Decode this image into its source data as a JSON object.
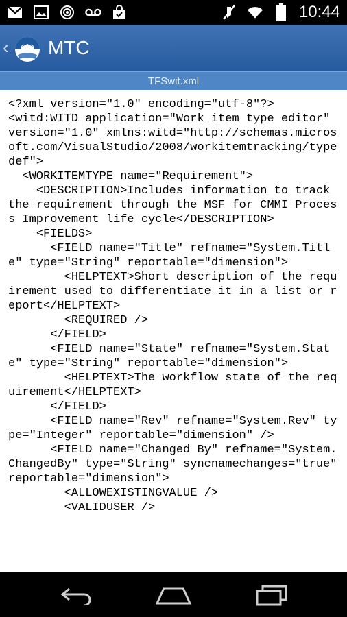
{
  "status_bar": {
    "time": "10:44",
    "left_icons": [
      "gmail-icon",
      "image-icon",
      "target-icon",
      "voicemail-icon",
      "shopping-bag-icon"
    ],
    "right_icons": [
      "silent-icon",
      "wifi-icon",
      "battery-icon"
    ]
  },
  "app_bar": {
    "title": "MTC",
    "subtitle": "TFSwit.xml",
    "brand_color": "#2f65a8"
  },
  "document": {
    "lines": [
      "<?xml version=\"1.0\" encoding=\"utf-8\"?>",
      "<witd:WITD application=\"Work item type editor\" version=\"1.0\" xmlns:witd=\"http://schemas.microsoft.com/VisualStudio/2008/workitemtracking/typedef\">",
      "  <WORKITEMTYPE name=\"Requirement\">",
      "    <DESCRIPTION>Includes information to track the requirement through the MSF for CMMI Process Improvement life cycle</DESCRIPTION>",
      "    <FIELDS>",
      "      <FIELD name=\"Title\" refname=\"System.Title\" type=\"String\" reportable=\"dimension\">",
      "        <HELPTEXT>Short description of the requirement used to differentiate it in a list or report</HELPTEXT>",
      "        <REQUIRED />",
      "      </FIELD>",
      "      <FIELD name=\"State\" refname=\"System.State\" type=\"String\" reportable=\"dimension\">",
      "        <HELPTEXT>The workflow state of the requirement</HELPTEXT>",
      "      </FIELD>",
      "      <FIELD name=\"Rev\" refname=\"System.Rev\" type=\"Integer\" reportable=\"dimension\" />",
      "      <FIELD name=\"Changed By\" refname=\"System.ChangedBy\" type=\"String\" syncnamechanges=\"true\" reportable=\"dimension\">",
      "        <ALLOWEXISTINGVALUE />",
      "        <VALIDUSER />"
    ]
  },
  "nav_bar": {
    "icons": [
      "back-icon",
      "home-icon",
      "recent-apps-icon"
    ]
  }
}
